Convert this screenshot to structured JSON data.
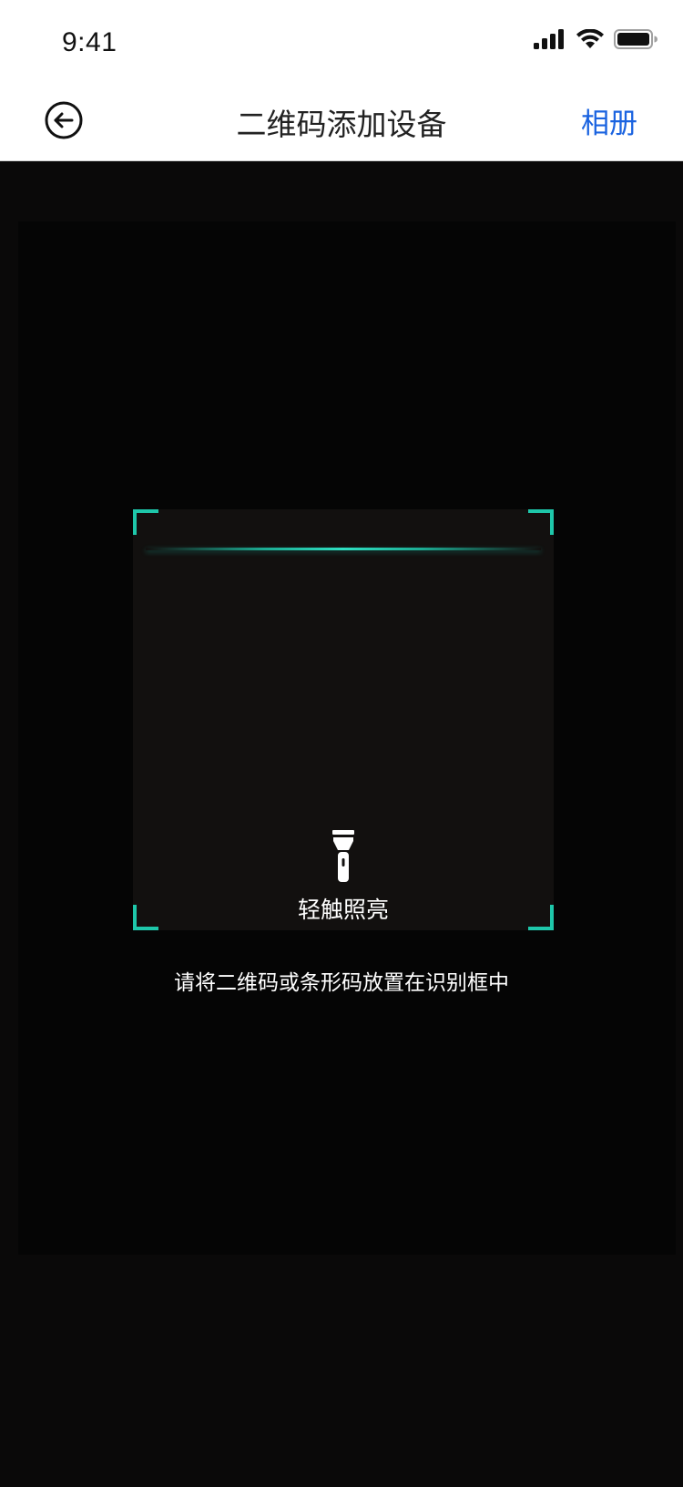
{
  "status_bar": {
    "time": "9:41"
  },
  "nav": {
    "back_icon": "back-arrow-circle-icon",
    "title": "二维码添加设备",
    "album_label": "相册",
    "album_color": "#1a63e0"
  },
  "scanner": {
    "accent_color": "#1ec7aa",
    "torch_icon": "flashlight-icon",
    "torch_label": "轻触照亮",
    "hint": "请将二维码或条形码放置在识别框中"
  }
}
